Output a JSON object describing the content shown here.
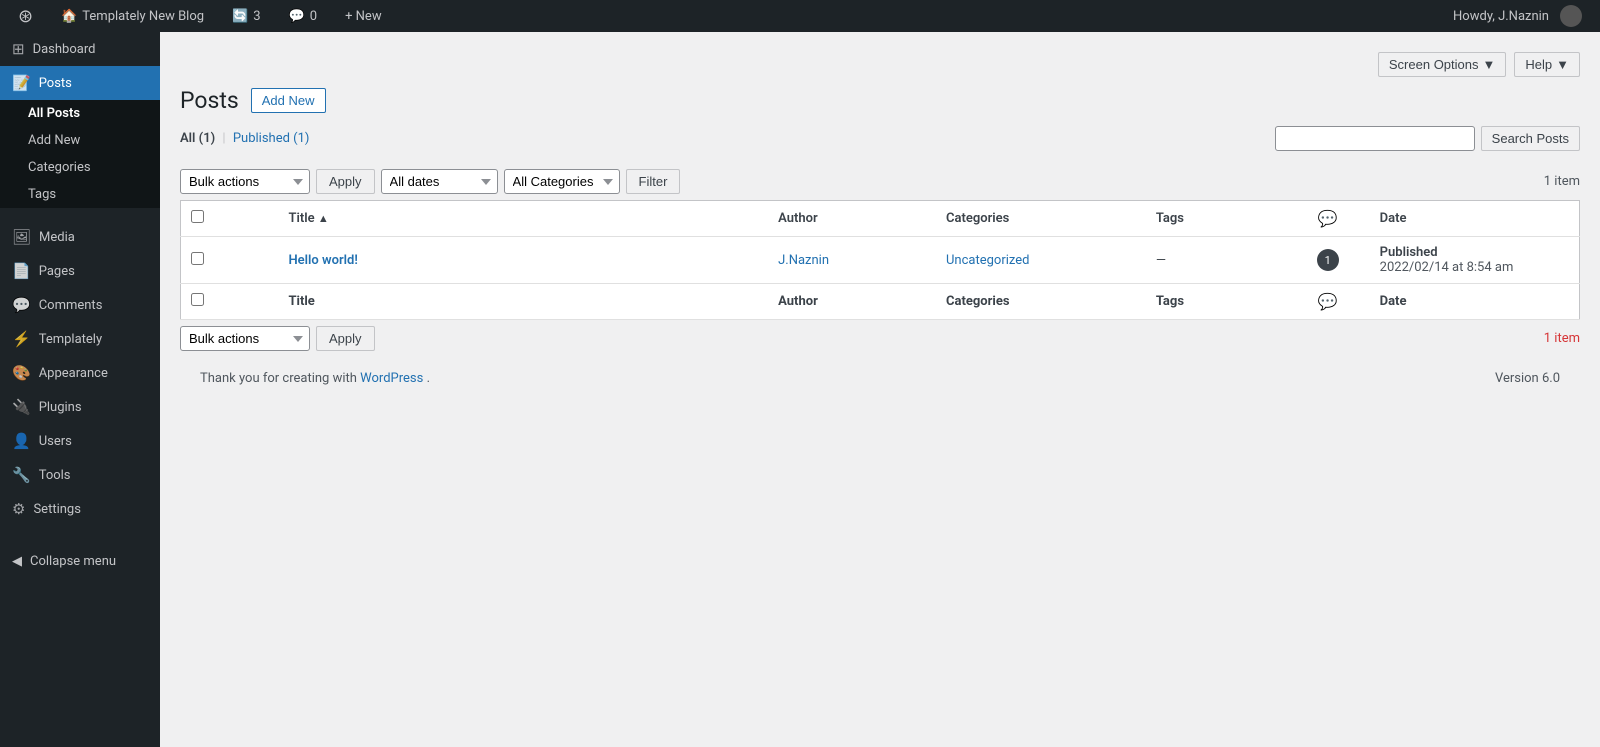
{
  "adminbar": {
    "site_name": "Templately New Blog",
    "updates_count": "3",
    "comments_count": "0",
    "new_label": "+ New",
    "howdy": "Howdy, J.Naznin"
  },
  "sidebar": {
    "items": [
      {
        "id": "dashboard",
        "label": "Dashboard",
        "icon": "⊞"
      },
      {
        "id": "posts",
        "label": "Posts",
        "icon": "📝",
        "active": true
      },
      {
        "id": "media",
        "label": "Media",
        "icon": "🖼"
      },
      {
        "id": "pages",
        "label": "Pages",
        "icon": "📄"
      },
      {
        "id": "comments",
        "label": "Comments",
        "icon": "💬"
      },
      {
        "id": "templately",
        "label": "Templately",
        "icon": "⚡"
      },
      {
        "id": "appearance",
        "label": "Appearance",
        "icon": "🎨"
      },
      {
        "id": "plugins",
        "label": "Plugins",
        "icon": "🔌"
      },
      {
        "id": "users",
        "label": "Users",
        "icon": "👤"
      },
      {
        "id": "tools",
        "label": "Tools",
        "icon": "🔧"
      },
      {
        "id": "settings",
        "label": "Settings",
        "icon": "⚙"
      }
    ],
    "submenu": [
      {
        "id": "all-posts",
        "label": "All Posts",
        "active": true
      },
      {
        "id": "add-new",
        "label": "Add New"
      },
      {
        "id": "categories",
        "label": "Categories"
      },
      {
        "id": "tags",
        "label": "Tags"
      }
    ],
    "collapse_label": "Collapse menu"
  },
  "topbar": {
    "screen_options_label": "Screen Options",
    "help_label": "Help"
  },
  "page": {
    "title": "Posts",
    "add_new_label": "Add New",
    "filter_all": "All",
    "filter_all_count": "(1)",
    "filter_sep": "|",
    "filter_published": "Published",
    "filter_published_count": "(1)",
    "items_count": "1 item",
    "bulk_actions_placeholder": "Bulk actions",
    "apply_label": "Apply",
    "all_dates_placeholder": "All dates",
    "all_categories_placeholder": "All Categories",
    "filter_label": "Filter",
    "search_placeholder": "",
    "search_btn_label": "Search Posts"
  },
  "table": {
    "top_controls": {
      "bulk_actions": "Bulk actions",
      "apply": "Apply",
      "all_dates": "All dates",
      "all_categories": "All Categories",
      "filter": "Filter",
      "items_count": "1 item"
    },
    "headers": [
      {
        "id": "title",
        "label": "Title",
        "sort_indicator": "▲"
      },
      {
        "id": "author",
        "label": "Author"
      },
      {
        "id": "categories",
        "label": "Categories"
      },
      {
        "id": "tags",
        "label": "Tags"
      },
      {
        "id": "comments",
        "label": "💬"
      },
      {
        "id": "date",
        "label": "Date"
      }
    ],
    "rows": [
      {
        "title": "Hello world!",
        "author": "J.Naznin",
        "categories": "Uncategorized",
        "tags": "—",
        "comments": "1",
        "date_status": "Published",
        "date_value": "2022/02/14 at 8:54 am"
      }
    ],
    "bottom_controls": {
      "bulk_actions": "Bulk actions",
      "apply": "Apply",
      "items_count": "1 item"
    }
  },
  "footer": {
    "thank_you_text": "Thank you for creating with ",
    "wp_link_text": "WordPress",
    "version": "Version 6.0"
  }
}
